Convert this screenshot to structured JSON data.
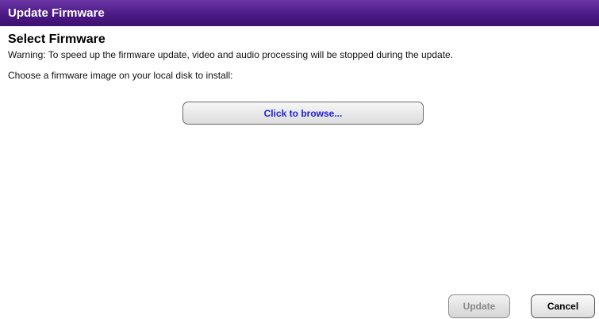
{
  "window": {
    "title": "Update Firmware"
  },
  "section": {
    "title": "Select Firmware",
    "warning": "Warning: To speed up the firmware update, video and audio processing will be stopped during the update.",
    "instruction": "Choose a firmware image on your local disk to install:"
  },
  "browse": {
    "label": "Click to browse..."
  },
  "actions": {
    "update_label": "Update",
    "update_enabled": false,
    "cancel_label": "Cancel"
  },
  "colors": {
    "titlebar": "#4c1a85",
    "browse_text": "#1d1ed8",
    "disabled_text": "#8a8a8a"
  }
}
